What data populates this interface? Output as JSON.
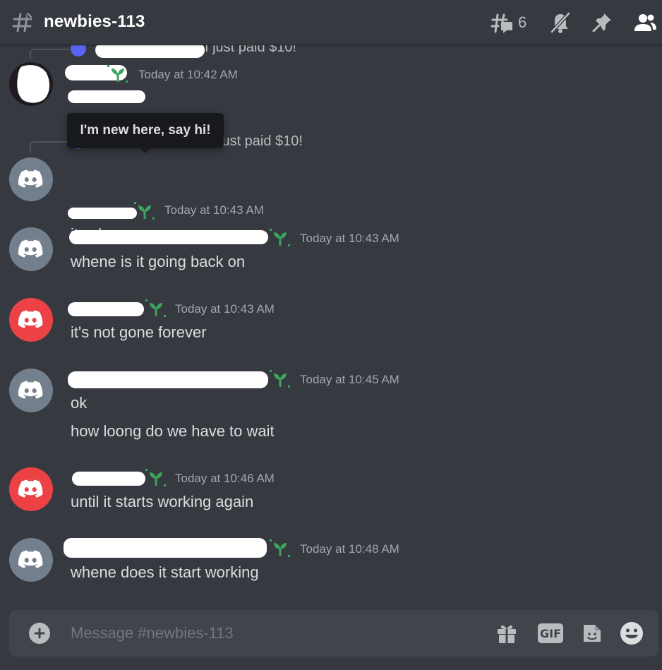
{
  "header": {
    "channel_name": "newbies-113",
    "thread_count": "6"
  },
  "tooltip": {
    "text": "I'm new here, say hi!"
  },
  "replies": [
    {
      "text": "I just paid $10!"
    },
    {
      "text": "just paid $10!"
    }
  ],
  "messages": [
    {
      "timestamp": "Today at 10:42 AM",
      "content": "ta malade"
    },
    {
      "timestamp": "Today at 10:43 AM",
      "content": "its shame"
    },
    {
      "timestamp": "Today at 10:43 AM",
      "content": "whene is it going back on"
    },
    {
      "timestamp": "Today at 10:43 AM",
      "content": "it's not gone forever"
    },
    {
      "timestamp": "Today at 10:45 AM",
      "content": "ok",
      "content_2": "how loong do we have to wait"
    },
    {
      "timestamp": "Today at 10:46 AM",
      "content": "until it starts working again"
    },
    {
      "timestamp": "Today at 10:48 AM",
      "content": "whene does it start working"
    }
  ],
  "composer": {
    "placeholder": "Message #newbies-113",
    "gif_label": "GIF"
  },
  "colors": {
    "background": "#36393f",
    "composer": "#40444b",
    "avatar_gray": "#747f8d",
    "avatar_red": "#ed4245",
    "new_member_badge": "#3ba55c",
    "tooltip": "#18191c"
  },
  "icons": [
    "channel-hash-icon",
    "threads-icon",
    "mute-bell-icon",
    "pin-icon",
    "members-icon",
    "discord-logo-icon",
    "sprout-badge-icon",
    "add-attachment-icon",
    "gift-icon",
    "gif-icon",
    "sticker-icon",
    "emoji-icon"
  ]
}
